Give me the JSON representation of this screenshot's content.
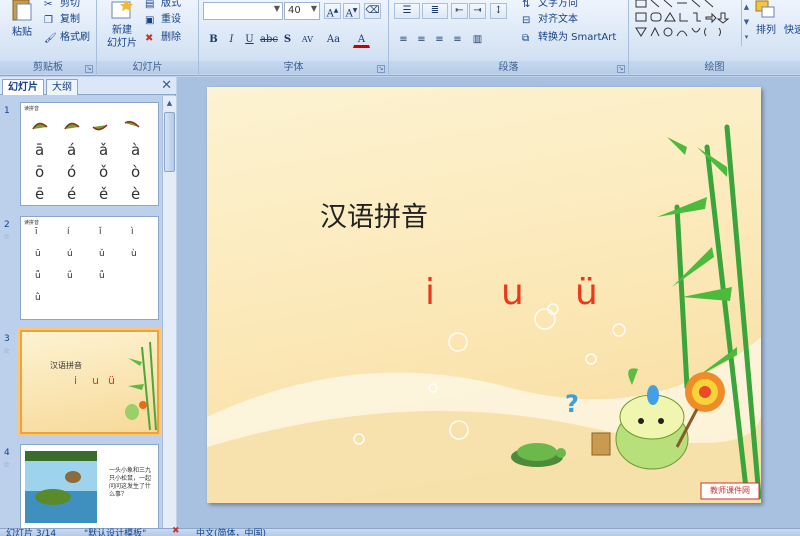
{
  "ribbon": {
    "clipboard": {
      "label": "剪贴板",
      "paste": "粘贴",
      "cut": "剪切",
      "copy": "复制",
      "format_painter": "格式刷"
    },
    "slides": {
      "label": "幻灯片",
      "new_slide": "新建\n幻灯片",
      "layout": "版式",
      "reset": "重设",
      "delete": "删除"
    },
    "font": {
      "label": "字体",
      "size_value": "40"
    },
    "paragraph": {
      "label": "段落",
      "text_direction": "文字方向",
      "align_text": "对齐文本",
      "convert_smartart": "转换为 SmartArt"
    },
    "drawing": {
      "label": "绘图",
      "arrange": "排列",
      "quick_styles": "快速"
    }
  },
  "left_panel": {
    "tabs": [
      "幻灯片",
      "大纲"
    ],
    "thumbs": [
      {
        "num": "1",
        "title": "读拼音",
        "rows": [
          [
            "ā",
            "á",
            "ǎ",
            "à"
          ],
          [
            "ō",
            "ó",
            "ǒ",
            "ò"
          ],
          [
            "ē",
            "é",
            "ě",
            "è"
          ]
        ]
      },
      {
        "num": "2",
        "title": "读拼音",
        "rows": [
          [
            "ī",
            "í",
            "ǐ",
            "ì"
          ],
          [
            "ū",
            "ú",
            "ǔ",
            "ù"
          ],
          [
            "ǖ",
            "ǘ",
            "ǚ",
            ""
          ],
          [
            "ǜ",
            "",
            "",
            ""
          ]
        ]
      },
      {
        "num": "3",
        "title": "汉语拼音",
        "letters": [
          "i",
          "u",
          "ü"
        ]
      },
      {
        "num": "4",
        "text": "一头小象和三九只小松鼠，一起问问这发生了什么事？"
      }
    ]
  },
  "slide": {
    "title": "汉语拼音",
    "letters": [
      "i",
      "u",
      "ü"
    ],
    "stamp": "教师课件网"
  },
  "status": {
    "slide_info": "幻灯片 3/14",
    "theme": "\"默认设计模板\"",
    "language": "中文(简体，中国)"
  },
  "colors": {
    "accent_red": "#e8391c",
    "ribbon_blue": "#15428b"
  }
}
